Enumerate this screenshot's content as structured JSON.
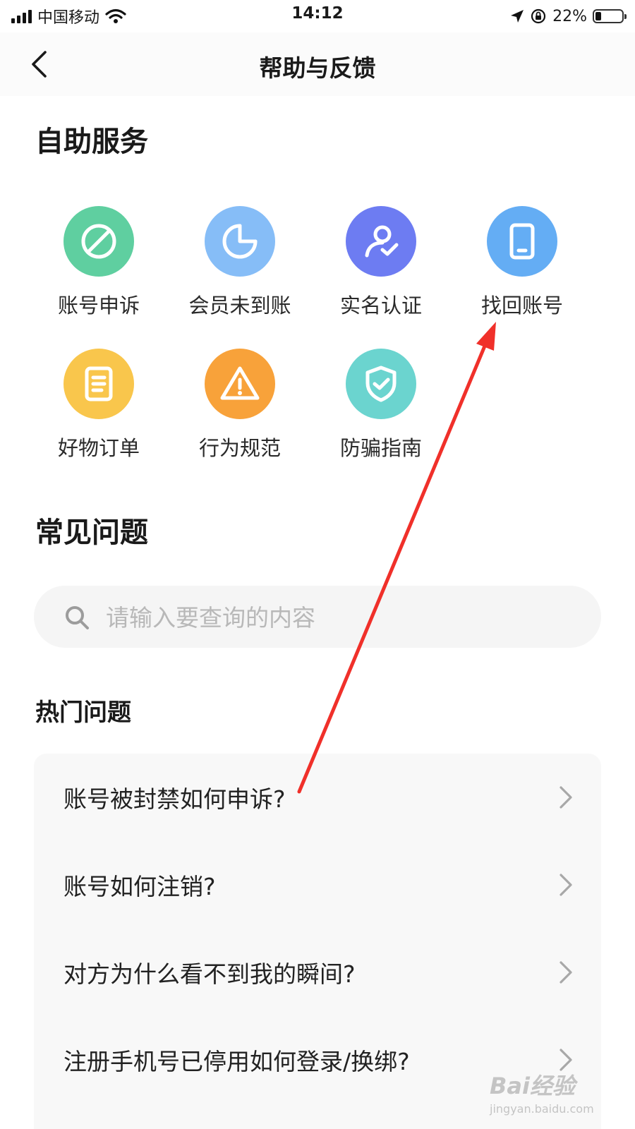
{
  "status_bar": {
    "carrier": "中国移动",
    "time": "14:12",
    "battery": "22%"
  },
  "nav": {
    "title": "帮助与反馈"
  },
  "self_service": {
    "title": "自助服务",
    "items": [
      {
        "label": "账号申诉",
        "icon": "ban-icon",
        "color": "#5fcfa0"
      },
      {
        "label": "会员未到账",
        "icon": "pie-chart-icon",
        "color": "#86bdf7"
      },
      {
        "label": "实名认证",
        "icon": "user-verify-icon",
        "color": "#6d7cf2"
      },
      {
        "label": "找回账号",
        "icon": "phone-icon",
        "color": "#64adf4"
      },
      {
        "label": "好物订单",
        "icon": "order-doc-icon",
        "color": "#f9c64c"
      },
      {
        "label": "行为规范",
        "icon": "warning-icon",
        "color": "#f8a23a"
      },
      {
        "label": "防骗指南",
        "icon": "shield-check-icon",
        "color": "#6bd4cf"
      }
    ]
  },
  "faq": {
    "title": "常见问题",
    "search_placeholder": "请输入要查询的内容",
    "hot_title": "热门问题",
    "questions": [
      "账号被封禁如何申诉?",
      "账号如何注销?",
      "对方为什么看不到我的瞬间?",
      "注册手机号已停用如何登录/换绑?"
    ]
  },
  "annotation": {
    "arrow_color": "#f0302a"
  },
  "watermark": {
    "brand": "Bai经验",
    "url": "jingyan.baidu.com"
  }
}
